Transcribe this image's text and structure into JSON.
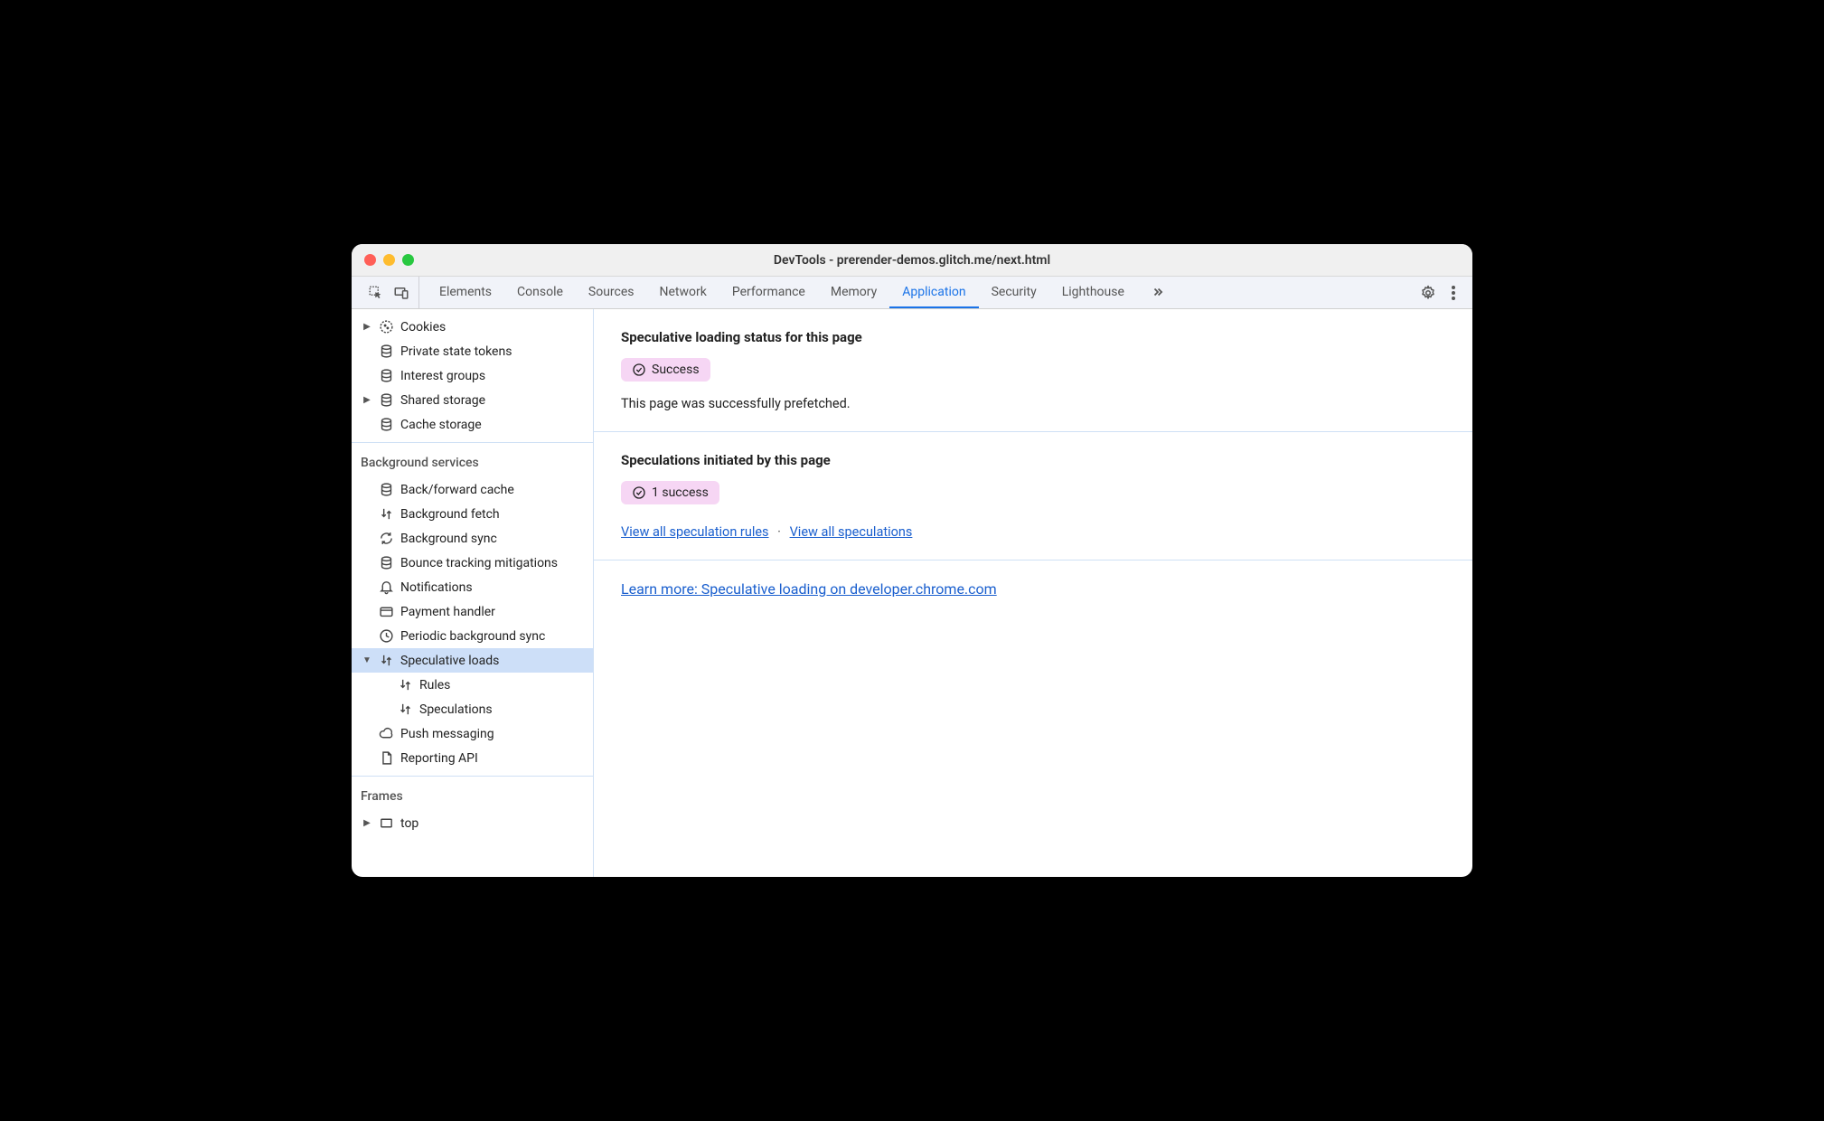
{
  "window": {
    "title": "DevTools - prerender-demos.glitch.me/next.html"
  },
  "tabs": [
    "Elements",
    "Console",
    "Sources",
    "Network",
    "Performance",
    "Memory",
    "Application",
    "Security",
    "Lighthouse"
  ],
  "active_tab": "Application",
  "sidebar": {
    "storage_items": [
      {
        "label": "Cookies",
        "icon": "cookie",
        "arrow": "right"
      },
      {
        "label": "Private state tokens",
        "icon": "db"
      },
      {
        "label": "Interest groups",
        "icon": "db"
      },
      {
        "label": "Shared storage",
        "icon": "db",
        "arrow": "right"
      },
      {
        "label": "Cache storage",
        "icon": "db"
      }
    ],
    "bg_title": "Background services",
    "bg_items": [
      {
        "label": "Back/forward cache",
        "icon": "db"
      },
      {
        "label": "Background fetch",
        "icon": "updown"
      },
      {
        "label": "Background sync",
        "icon": "sync"
      },
      {
        "label": "Bounce tracking mitigations",
        "icon": "db"
      },
      {
        "label": "Notifications",
        "icon": "bell"
      },
      {
        "label": "Payment handler",
        "icon": "card"
      },
      {
        "label": "Periodic background sync",
        "icon": "clock"
      },
      {
        "label": "Speculative loads",
        "icon": "updown",
        "arrow": "down",
        "selected": true
      },
      {
        "label": "Rules",
        "icon": "updown",
        "sub": true
      },
      {
        "label": "Speculations",
        "icon": "updown",
        "sub": true
      },
      {
        "label": "Push messaging",
        "icon": "cloud"
      },
      {
        "label": "Reporting API",
        "icon": "doc"
      }
    ],
    "frames_title": "Frames",
    "frames_items": [
      {
        "label": "top",
        "icon": "frame",
        "arrow": "right"
      }
    ]
  },
  "main": {
    "section1_title": "Speculative loading status for this page",
    "section1_pill": "Success",
    "section1_desc": "This page was successfully prefetched.",
    "section2_title": "Speculations initiated by this page",
    "section2_pill": "1 success",
    "link_rules": "View all speculation rules",
    "link_specs": "View all speculations",
    "learn_more": "Learn more: Speculative loading on developer.chrome.com"
  }
}
